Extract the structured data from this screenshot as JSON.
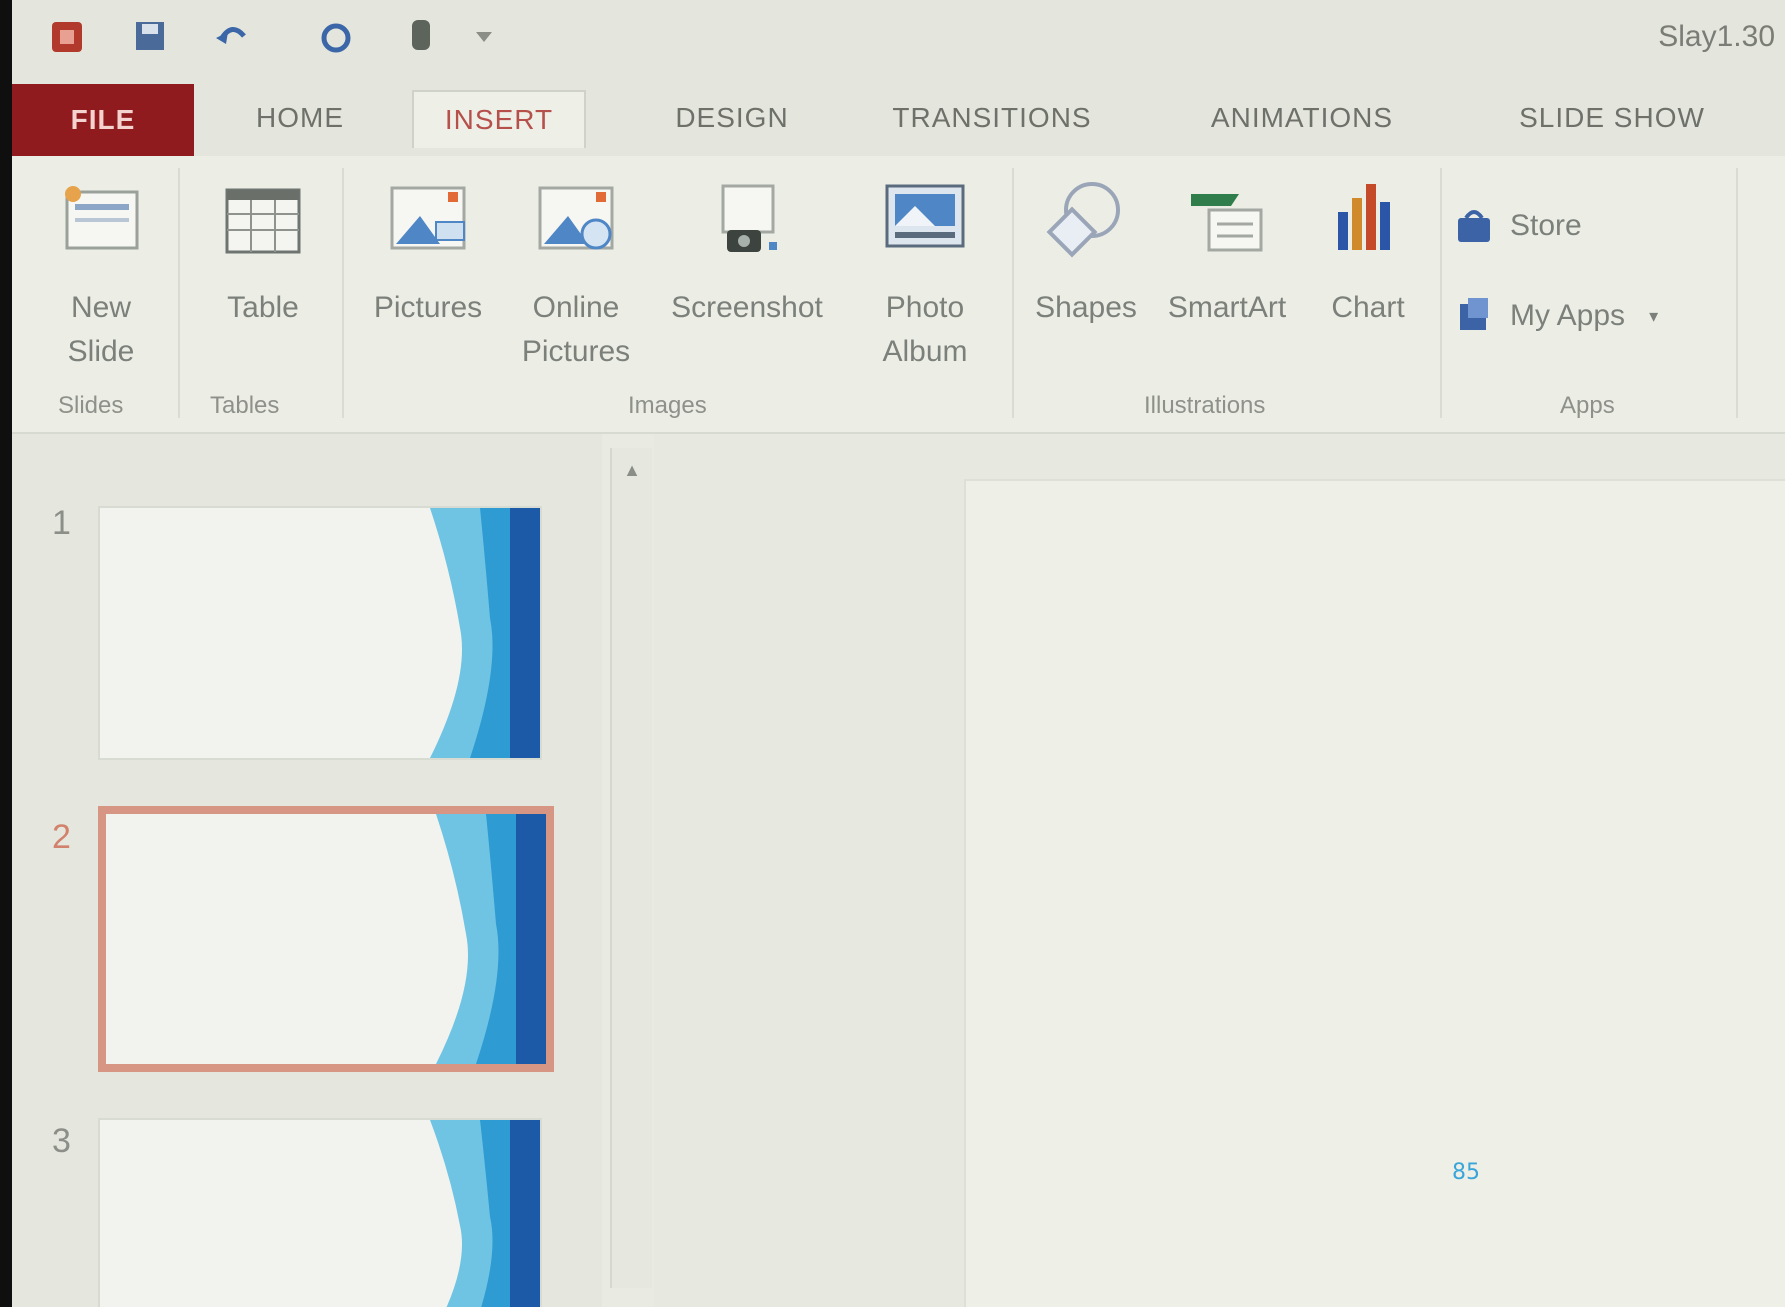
{
  "window": {
    "doc_title": "Slay1.30"
  },
  "quick_access": {
    "icons": [
      "app-icon",
      "save-icon",
      "undo-icon",
      "redo-icon",
      "touch-mode-icon",
      "customize-icon"
    ]
  },
  "tabs": [
    {
      "label": "FILE"
    },
    {
      "label": "HOME"
    },
    {
      "label": "INSERT"
    },
    {
      "label": "DESIGN"
    },
    {
      "label": "TRANSITIONS"
    },
    {
      "label": "ANIMATIONS"
    },
    {
      "label": "SLIDE SHOW"
    }
  ],
  "ribbon": {
    "groups": {
      "slides": "Slides",
      "tables": "Tables",
      "images": "Images",
      "illustrations": "Illustrations",
      "apps": "Apps"
    },
    "buttons": {
      "new_slide": "New Slide",
      "table": "Table",
      "pictures": "Pictures",
      "online_pictures": "Online Pictures",
      "screenshot": "Screenshot",
      "photo_album": "Photo Album",
      "shapes": "Shapes",
      "smartart": "SmartArt",
      "chart": "Chart",
      "store": "Store",
      "my_apps": "My Apps"
    }
  },
  "slides_pane": {
    "thumbnails": [
      {
        "number": "1",
        "selected": false
      },
      {
        "number": "2",
        "selected": true
      },
      {
        "number": "3",
        "selected": false
      }
    ]
  },
  "page_number": "85",
  "colors": {
    "file_tab": "#8f1b1e",
    "selection_border": "#d79684",
    "theme_blue": "#2a8fd0",
    "page_number": "#3aa5d8"
  }
}
